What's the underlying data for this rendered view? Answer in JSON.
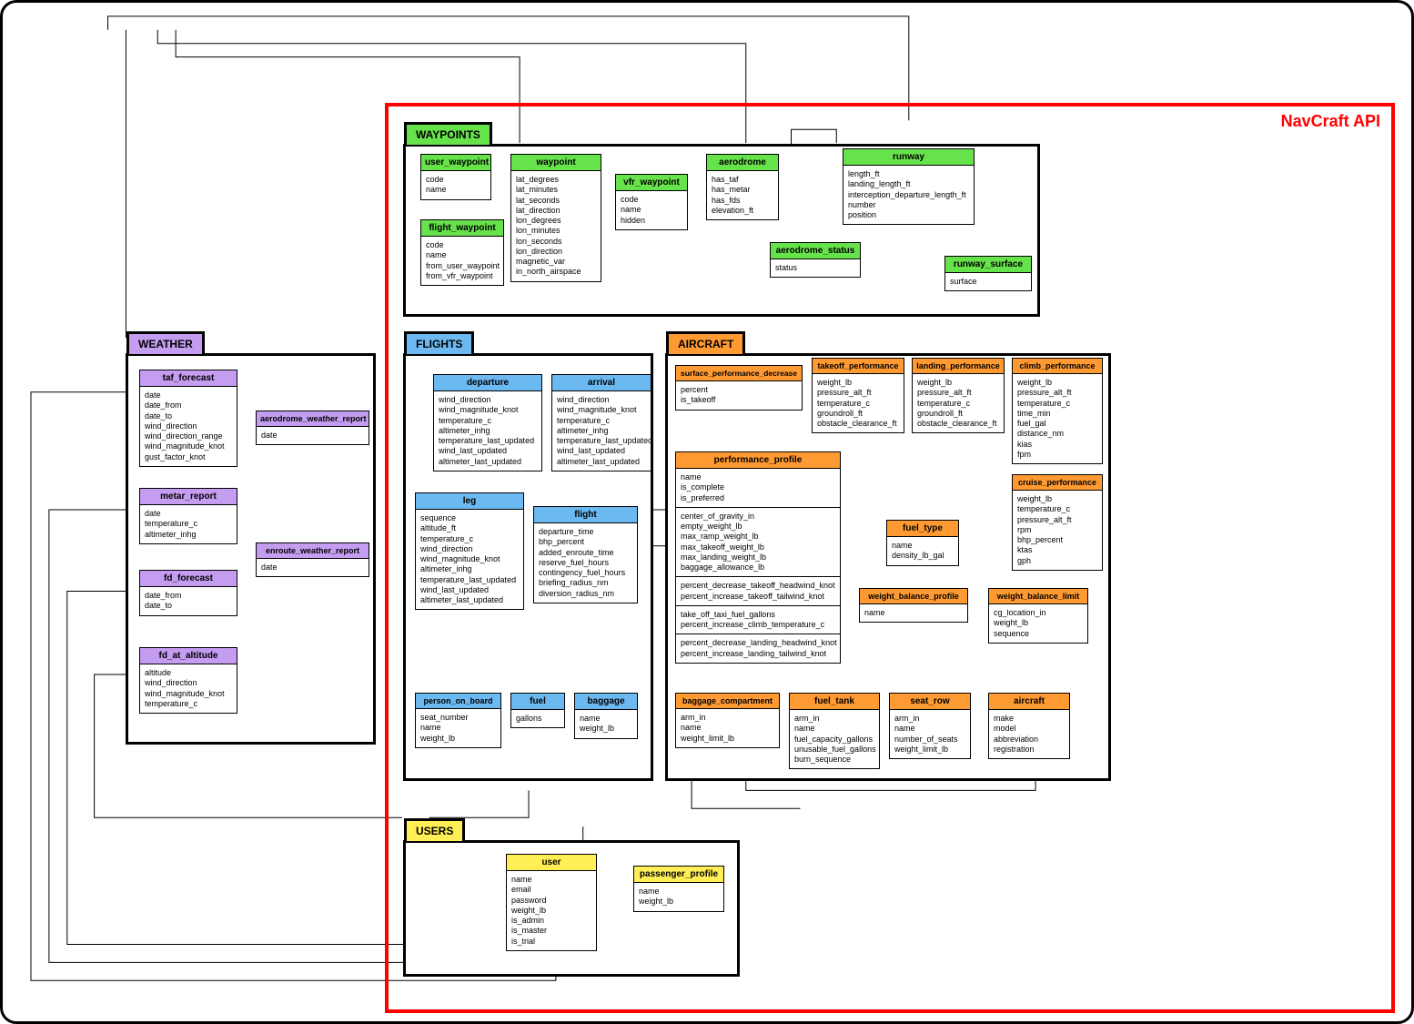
{
  "api_title": "NavCraft API",
  "modules": {
    "waypoints": "WAYPOINTS",
    "weather": "WEATHER",
    "flights": "FLIGHTS",
    "aircraft": "AIRCRAFT",
    "users": "USERS"
  },
  "colors": {
    "api_border": "#ff0000",
    "waypoints": "#66e24a",
    "weather": "#c49cf0",
    "flights": "#6cb8f0",
    "aircraft": "#ff9a33",
    "users": "#ffee55"
  },
  "entities": {
    "user_waypoint": {
      "title": "user_waypoint",
      "fields": [
        "code",
        "name"
      ]
    },
    "flight_waypoint": {
      "title": "flight_waypoint",
      "fields": [
        "code",
        "name",
        "from_user_waypoint",
        "from_vfr_waypoint"
      ]
    },
    "waypoint": {
      "title": "waypoint",
      "fields": [
        "lat_degrees",
        "lat_minutes",
        "lat_seconds",
        "lat_direction",
        "lon_degrees",
        "lon_minutes",
        "lon_seconds",
        "lon_direction",
        "magnetic_var",
        "in_north_airspace"
      ]
    },
    "vfr_waypoint": {
      "title": "vfr_waypoint",
      "fields": [
        "code",
        "name",
        "hidden"
      ]
    },
    "aerodrome": {
      "title": "aerodrome",
      "fields": [
        "has_taf",
        "has_metar",
        "has_fds",
        "elevation_ft"
      ]
    },
    "aerodrome_status": {
      "title": "aerodrome_status",
      "fields": [
        "status"
      ]
    },
    "runway": {
      "title": "runway",
      "fields": [
        "length_ft",
        "landing_length_ft",
        "interception_departure_length_ft",
        "number",
        "position"
      ]
    },
    "runway_surface": {
      "title": "runway_surface",
      "fields": [
        "surface"
      ]
    },
    "taf_forecast": {
      "title": "taf_forecast",
      "fields": [
        "date",
        "date_from",
        "date_to",
        "wind_direction",
        "wind_direction_range",
        "wind_magnitude_knot",
        "gust_factor_knot"
      ]
    },
    "metar_report": {
      "title": "metar_report",
      "fields": [
        "date",
        "temperature_c",
        "altimeter_inhg"
      ]
    },
    "fd_forecast": {
      "title": "fd_forecast",
      "fields": [
        "date_from",
        "date_to"
      ]
    },
    "fd_at_altitude": {
      "title": "fd_at_altitude",
      "fields": [
        "altitude",
        "wind_direction",
        "wind_magnitude_knot",
        "temperature_c"
      ]
    },
    "aerodrome_weather_report": {
      "title": "aerodrome_weather_report",
      "fields": [
        "date"
      ]
    },
    "enroute_weather_report": {
      "title": "enroute_weather_report",
      "fields": [
        "date"
      ]
    },
    "departure": {
      "title": "departure",
      "fields": [
        "wind_direction",
        "wind_magnitude_knot",
        "temperature_c",
        "altimeter_inhg",
        "temperature_last_updated",
        "wind_last_updated",
        "altimeter_last_updated"
      ]
    },
    "arrival": {
      "title": "arrival",
      "fields": [
        "wind_direction",
        "wind_magnitude_knot",
        "temperature_c",
        "altimeter_inhg",
        "temperature_last_updated",
        "wind_last_updated",
        "altimeter_last_updated"
      ]
    },
    "leg": {
      "title": "leg",
      "fields": [
        "sequence",
        "altitude_ft",
        "temperature_c",
        "wind_direction",
        "wind_magnitude_knot",
        "altimeter_inhg",
        "temperature_last_updated",
        "wind_last_updated",
        "altimeter_last_updated"
      ]
    },
    "flight": {
      "title": "flight",
      "fields": [
        "departure_time",
        "bhp_percent",
        "added_enroute_time",
        "reserve_fuel_hours",
        "contingency_fuel_hours",
        "briefing_radius_nm",
        "diversion_radius_nm"
      ]
    },
    "person_on_board": {
      "title": "person_on_board",
      "fields": [
        "seat_number",
        "name",
        "weight_lb"
      ]
    },
    "fuel": {
      "title": "fuel",
      "fields": [
        "gallons"
      ]
    },
    "baggage": {
      "title": "baggage",
      "fields": [
        "name",
        "weight_lb"
      ]
    },
    "surface_performance_decrease": {
      "title": "surface_performance_decrease",
      "fields": [
        "percent",
        "is_takeoff"
      ]
    },
    "takeoff_performance": {
      "title": "takeoff_performance",
      "fields": [
        "weight_lb",
        "pressure_alt_ft",
        "temperature_c",
        "groundroll_ft",
        "obstacle_clearance_ft"
      ]
    },
    "landing_performance": {
      "title": "landing_performance",
      "fields": [
        "weight_lb",
        "pressure_alt_ft",
        "temperature_c",
        "groundroll_ft",
        "obstacle_clearance_ft"
      ]
    },
    "climb_performance": {
      "title": "climb_performance",
      "fields": [
        "weight_lb",
        "pressure_alt_ft",
        "temperature_c",
        "time_min",
        "fuel_gal",
        "distance_nm",
        "kias",
        "fpm"
      ]
    },
    "cruise_performance": {
      "title": "cruise_performance",
      "fields": [
        "weight_lb",
        "temperature_c",
        "pressure_alt_ft",
        "rpm",
        "bhp_percent",
        "ktas",
        "gph"
      ]
    },
    "performance_profile": {
      "title": "performance_profile",
      "sections": [
        [
          "name",
          "is_complete",
          "is_preferred"
        ],
        [
          "center_of_gravity_in",
          "empty_weight_lb",
          "max_ramp_weight_lb",
          "max_takeoff_weight_lb",
          "max_landing_weight_lb",
          "baggage_allowance_lb"
        ],
        [
          "percent_decrease_takeoff_headwind_knot",
          "percent_increase_takeoff_tailwind_knot"
        ],
        [
          "take_off_taxi_fuel_gallons",
          "percent_increase_climb_temperature_c"
        ],
        [
          "percent_decrease_landing_headwind_knot",
          "percent_increase_landing_tailwind_knot"
        ]
      ]
    },
    "fuel_type": {
      "title": "fuel_type",
      "fields": [
        "name",
        "density_lb_gal"
      ]
    },
    "weight_balance_profile": {
      "title": "weight_balance_profile",
      "fields": [
        "name"
      ]
    },
    "weight_balance_limit": {
      "title": "weight_balance_limit",
      "fields": [
        "cg_location_in",
        "weight_lb",
        "sequence"
      ]
    },
    "baggage_compartment": {
      "title": "baggage_compartment",
      "fields": [
        "arm_in",
        "name",
        "weight_limit_lb"
      ]
    },
    "fuel_tank": {
      "title": "fuel_tank",
      "fields": [
        "arm_in",
        "name",
        "fuel_capacity_gallons",
        "unusable_fuel_gallons",
        "burn_sequence"
      ]
    },
    "seat_row": {
      "title": "seat_row",
      "fields": [
        "arm_in",
        "name",
        "number_of_seats",
        "weight_limit_lb"
      ]
    },
    "aircraft": {
      "title": "aircraft",
      "fields": [
        "make",
        "model",
        "abbreviation",
        "registration"
      ]
    },
    "user": {
      "title": "user",
      "fields": [
        "name",
        "email",
        "password",
        "weight_lb",
        "is_admin",
        "is_master",
        "is_trial"
      ]
    },
    "passenger_profile": {
      "title": "passenger_profile",
      "fields": [
        "name",
        "weight_lb"
      ]
    }
  }
}
